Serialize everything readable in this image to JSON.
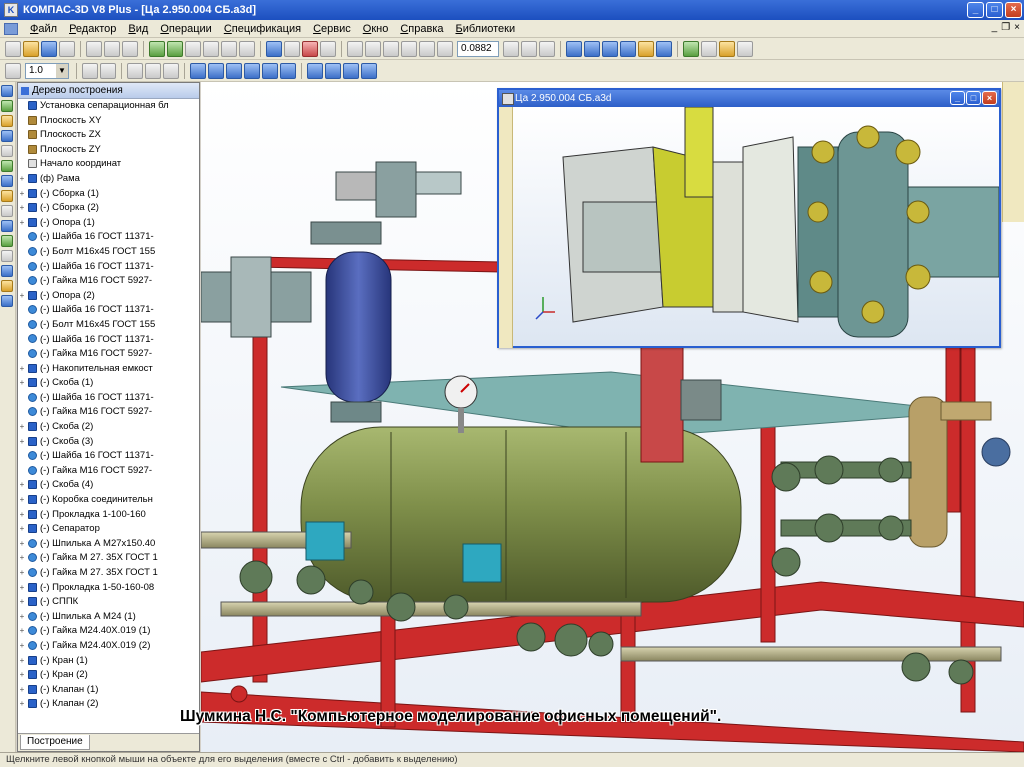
{
  "window": {
    "title": "КОМПАС-3D V8 Plus - [Ца 2.950.004 СБ.a3d]",
    "buttons": {
      "minimize": "_",
      "maximize": "□",
      "close": "×"
    }
  },
  "menu": {
    "items": [
      "Файл",
      "Редактор",
      "Вид",
      "Операции",
      "Спецификация",
      "Сервис",
      "Окно",
      "Справка",
      "Библиотеки"
    ],
    "mdi_buttons": {
      "minimize": "_",
      "restore": "❐",
      "close": "×"
    }
  },
  "toolbar": {
    "zoom_value": "0.0882",
    "step_value": "1.0"
  },
  "tree": {
    "title": "Дерево построения",
    "footer_tab": "Построение",
    "items": [
      {
        "exp": "",
        "icon": "asm",
        "label": "Установка сепарационная бл"
      },
      {
        "exp": "",
        "icon": "plane",
        "label": "Плоскость XY"
      },
      {
        "exp": "",
        "icon": "plane",
        "label": "Плоскость ZX"
      },
      {
        "exp": "",
        "icon": "plane",
        "label": "Плоскость ZY"
      },
      {
        "exp": "",
        "icon": "origin",
        "label": "Начало координат"
      },
      {
        "exp": "+",
        "icon": "asm",
        "label": "(ф) Рама"
      },
      {
        "exp": "+",
        "icon": "asm",
        "label": "(-) Сборка (1)"
      },
      {
        "exp": "+",
        "icon": "asm",
        "label": "(-) Сборка (2)"
      },
      {
        "exp": "+",
        "icon": "asm",
        "label": "(-) Опора (1)"
      },
      {
        "exp": "",
        "icon": "part",
        "label": "(-) Шайба 16 ГОСТ 11371-"
      },
      {
        "exp": "",
        "icon": "part",
        "label": "(-) Болт М16х45 ГОСТ 155"
      },
      {
        "exp": "",
        "icon": "part",
        "label": "(-) Шайба 16 ГОСТ 11371-"
      },
      {
        "exp": "",
        "icon": "part",
        "label": "(-) Гайка М16 ГОСТ 5927-"
      },
      {
        "exp": "+",
        "icon": "asm",
        "label": "(-) Опора (2)"
      },
      {
        "exp": "",
        "icon": "part",
        "label": "(-) Шайба 16 ГОСТ 11371-"
      },
      {
        "exp": "",
        "icon": "part",
        "label": "(-) Болт М16х45 ГОСТ 155"
      },
      {
        "exp": "",
        "icon": "part",
        "label": "(-) Шайба 16 ГОСТ 11371-"
      },
      {
        "exp": "",
        "icon": "part",
        "label": "(-) Гайка М16 ГОСТ 5927-"
      },
      {
        "exp": "+",
        "icon": "asm",
        "label": "(-) Накопительная емкост"
      },
      {
        "exp": "+",
        "icon": "asm",
        "label": "(-) Скоба (1)"
      },
      {
        "exp": "",
        "icon": "part",
        "label": "(-) Шайба 16 ГОСТ 11371-"
      },
      {
        "exp": "",
        "icon": "part",
        "label": "(-) Гайка М16 ГОСТ 5927-"
      },
      {
        "exp": "+",
        "icon": "asm",
        "label": "(-) Скоба (2)"
      },
      {
        "exp": "+",
        "icon": "asm",
        "label": "(-) Скоба (3)"
      },
      {
        "exp": "",
        "icon": "part",
        "label": "(-) Шайба 16 ГОСТ 11371-"
      },
      {
        "exp": "",
        "icon": "part",
        "label": "(-) Гайка М16 ГОСТ 5927-"
      },
      {
        "exp": "+",
        "icon": "asm",
        "label": "(-) Скоба (4)"
      },
      {
        "exp": "+",
        "icon": "asm",
        "label": "(-) Коробка соединительн"
      },
      {
        "exp": "+",
        "icon": "asm",
        "label": "(-) Прокладка 1-100-160"
      },
      {
        "exp": "+",
        "icon": "asm",
        "label": "(-) Сепаратор"
      },
      {
        "exp": "+",
        "icon": "part",
        "label": "(-) Шпилька А М27х150.40"
      },
      {
        "exp": "+",
        "icon": "part",
        "label": "(-) Гайка М 27. 35Х ГОСТ 1"
      },
      {
        "exp": "+",
        "icon": "part",
        "label": "(-) Гайка М 27. 35Х ГОСТ 1"
      },
      {
        "exp": "+",
        "icon": "asm",
        "label": "(-) Прокладка 1-50-160-08"
      },
      {
        "exp": "+",
        "icon": "asm",
        "label": "(-) СППК"
      },
      {
        "exp": "+",
        "icon": "part",
        "label": "(-) Шпилька А М24 (1)"
      },
      {
        "exp": "+",
        "icon": "part",
        "label": "(-) Гайка М24.40Х.019 (1)"
      },
      {
        "exp": "+",
        "icon": "part",
        "label": "(-) Гайка М24.40Х.019 (2)"
      },
      {
        "exp": "+",
        "icon": "asm",
        "label": "(-) Кран (1)"
      },
      {
        "exp": "+",
        "icon": "asm",
        "label": "(-) Кран (2)"
      },
      {
        "exp": "+",
        "icon": "asm",
        "label": "(-) Клапан (1)"
      },
      {
        "exp": "+",
        "icon": "asm",
        "label": "(-) Клапан (2)"
      }
    ]
  },
  "inset_window": {
    "title": "Ца 2.950.004 СБ.a3d",
    "buttons": {
      "minimize": "_",
      "maximize": "□",
      "close": "×"
    }
  },
  "caption": "Шумкина Н.С. \"Компьютерное моделирование офисных помещений\".",
  "statusbar": {
    "text": "Щелкните левой кнопкой мыши на объекте для его выделения (вместе с Ctrl - добавить к выделению)"
  },
  "colors": {
    "frame": "#cc2b2b",
    "vessel": "#7f8f4a",
    "vertical_vessel": "#3d4fa0",
    "platform": "#7fb3b0",
    "valves": "#5f7a58",
    "titlebar": "#2a5fd0"
  }
}
